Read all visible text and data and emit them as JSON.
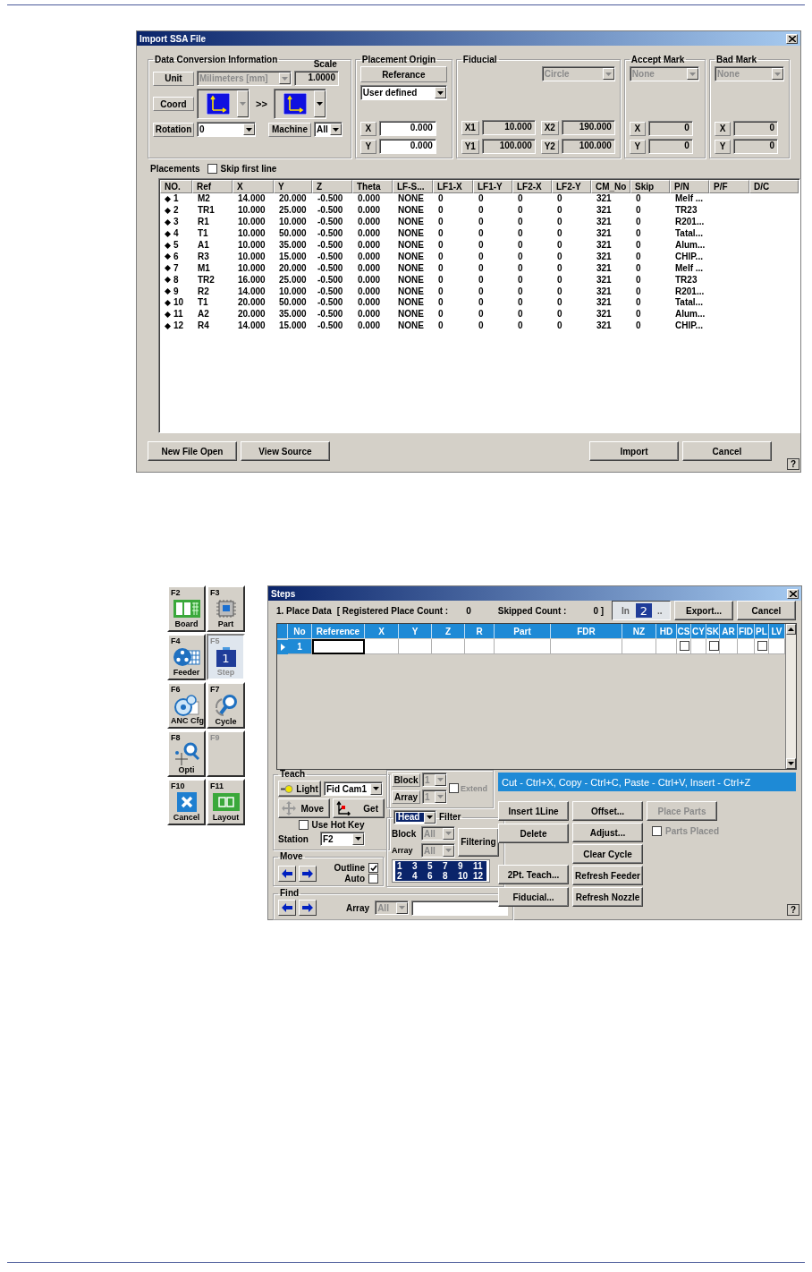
{
  "import_dialog": {
    "title": "Import SSA File",
    "conversion": {
      "title": "Data Conversion Information",
      "scale_label": "Scale",
      "unit_label": "Unit",
      "unit": {
        "value": "Milimeters [mm]",
        "disabled": true
      },
      "scale": {
        "value": "1.0000",
        "disabled": true
      },
      "coord_label": "Coord",
      "from_coord": {
        "disabled": true
      },
      "coord_sep": ">>",
      "to_coord": {
        "disabled": false
      },
      "rotation_label": "Rotation",
      "rotation": {
        "value": "0",
        "disabled": false
      },
      "machine_label": "Machine",
      "machine": {
        "value": "All",
        "disabled": false
      }
    },
    "origin": {
      "title": "Placement Origin",
      "reference_label": "Referance",
      "mode": {
        "value": "User defined",
        "disabled": false
      },
      "x_label": "X",
      "x": {
        "value": "0.000",
        "disabled": false
      },
      "y_label": "Y",
      "y": {
        "value": "0.000",
        "disabled": false
      }
    },
    "fiducial": {
      "title": "Fiducial",
      "shape": {
        "value": "Circle",
        "disabled": true
      },
      "points": [
        {
          "label": "X1",
          "value": "10.000",
          "disabled": true
        },
        {
          "label": "X2",
          "value": "190.000",
          "disabled": true
        },
        {
          "label": "Y1",
          "value": "100.000",
          "disabled": true
        },
        {
          "label": "Y2",
          "value": "100.000",
          "disabled": true
        }
      ]
    },
    "marks": [
      {
        "title": "Accept Mark",
        "type": {
          "value": "None",
          "disabled": true
        },
        "x_label": "X",
        "x": {
          "value": "0",
          "disabled": true
        },
        "y_label": "Y",
        "y": {
          "value": "0",
          "disabled": true
        }
      },
      {
        "title": "Bad Mark",
        "type": {
          "value": "None",
          "disabled": true
        },
        "x_label": "X",
        "x": {
          "value": "0",
          "disabled": true
        },
        "y_label": "Y",
        "y": {
          "value": "0",
          "disabled": true
        }
      }
    ],
    "placements_label": "Placements",
    "skip_first_line": {
      "label": "Skip first line",
      "checked": false
    },
    "table": {
      "columns": [
        "NO.",
        "Ref",
        "X",
        "Y",
        "Z",
        "Theta",
        "LF-S...",
        "LF1-X",
        "LF1-Y",
        "LF2-X",
        "LF2-Y",
        "CM_No",
        "Skip",
        "P/N",
        "P/F",
        "D/C"
      ],
      "rows": [
        {
          "cells": [
            "1",
            "M2",
            "14.000",
            "20.000",
            "-0.500",
            "0.000",
            "NONE",
            "0",
            "0",
            "0",
            "0",
            "321",
            "0",
            "Melf ..."
          ]
        },
        {
          "cells": [
            "2",
            "TR1",
            "10.000",
            "25.000",
            "-0.500",
            "0.000",
            "NONE",
            "0",
            "0",
            "0",
            "0",
            "321",
            "0",
            "TR23"
          ]
        },
        {
          "cells": [
            "3",
            "R1",
            "10.000",
            "10.000",
            "-0.500",
            "0.000",
            "NONE",
            "0",
            "0",
            "0",
            "0",
            "321",
            "0",
            "R201..."
          ]
        },
        {
          "cells": [
            "4",
            "T1",
            "10.000",
            "50.000",
            "-0.500",
            "0.000",
            "NONE",
            "0",
            "0",
            "0",
            "0",
            "321",
            "0",
            "Tatal..."
          ]
        },
        {
          "cells": [
            "5",
            "A1",
            "10.000",
            "35.000",
            "-0.500",
            "0.000",
            "NONE",
            "0",
            "0",
            "0",
            "0",
            "321",
            "0",
            "Alum..."
          ]
        },
        {
          "cells": [
            "6",
            "R3",
            "10.000",
            "15.000",
            "-0.500",
            "0.000",
            "NONE",
            "0",
            "0",
            "0",
            "0",
            "321",
            "0",
            "CHIP..."
          ]
        },
        {
          "cells": [
            "7",
            "M1",
            "10.000",
            "20.000",
            "-0.500",
            "0.000",
            "NONE",
            "0",
            "0",
            "0",
            "0",
            "321",
            "0",
            "Melf ..."
          ]
        },
        {
          "cells": [
            "8",
            "TR2",
            "16.000",
            "25.000",
            "-0.500",
            "0.000",
            "NONE",
            "0",
            "0",
            "0",
            "0",
            "321",
            "0",
            "TR23"
          ]
        },
        {
          "cells": [
            "9",
            "R2",
            "14.000",
            "10.000",
            "-0.500",
            "0.000",
            "NONE",
            "0",
            "0",
            "0",
            "0",
            "321",
            "0",
            "R201..."
          ]
        },
        {
          "cells": [
            "10",
            "T1",
            "20.000",
            "50.000",
            "-0.500",
            "0.000",
            "NONE",
            "0",
            "0",
            "0",
            "0",
            "321",
            "0",
            "Tatal..."
          ]
        },
        {
          "cells": [
            "11",
            "A2",
            "20.000",
            "35.000",
            "-0.500",
            "0.000",
            "NONE",
            "0",
            "0",
            "0",
            "0",
            "321",
            "0",
            "Alum..."
          ]
        },
        {
          "cells": [
            "12",
            "R4",
            "14.000",
            "15.000",
            "-0.500",
            "0.000",
            "NONE",
            "0",
            "0",
            "0",
            "0",
            "321",
            "0",
            "CHIP..."
          ]
        }
      ]
    },
    "left_buttons": [
      "New File Open",
      "View Source"
    ],
    "right_buttons": [
      "Import",
      "Cancel"
    ],
    "help": "?"
  },
  "function_keys": [
    {
      "key": "F2",
      "label": "Board",
      "selected": false,
      "disabled": false
    },
    {
      "key": "F3",
      "label": "Part",
      "selected": false,
      "disabled": false
    },
    {
      "key": "F4",
      "label": "Feeder",
      "selected": false,
      "disabled": false
    },
    {
      "key": "F5",
      "label": "Step",
      "selected": true,
      "disabled": false,
      "callout": "1"
    },
    {
      "key": "F6",
      "label": "ANC Cfg",
      "selected": false,
      "disabled": false
    },
    {
      "key": "F7",
      "label": "Cycle",
      "selected": false,
      "disabled": false
    },
    {
      "key": "F8",
      "label": "Opti",
      "selected": false,
      "disabled": false
    },
    {
      "key": "F9",
      "selected": false,
      "disabled": true
    },
    {
      "key": "F10",
      "label": "Cancel",
      "selected": false,
      "disabled": false
    },
    {
      "key": "F11",
      "label": "Layout",
      "selected": false,
      "disabled": false
    }
  ],
  "steps_dialog": {
    "title": "Steps",
    "place_data": "1. Place Data",
    "registered_label": "[ Registered Place Count :",
    "registered_value": "0",
    "skipped_label": "Skipped Count :",
    "skipped_value": "0 ]",
    "buttons": [
      {
        "label": "In",
        "tail": "..",
        "pressed": true,
        "callout": "2"
      },
      {
        "label": "Export...",
        "pressed": false
      },
      {
        "label": "Cancel",
        "pressed": false
      }
    ],
    "grid": {
      "columns": [
        "No",
        "Reference",
        "X",
        "Y",
        "Z",
        "R",
        "Part",
        "FDR",
        "NZ",
        "HD",
        "CS",
        "CY",
        "SK",
        "AR",
        "FID",
        "PL",
        "LV"
      ],
      "rows": [
        {
          "selected": true,
          "cells": [
            {
              "kind": "text",
              "value": "1"
            },
            {
              "kind": "edit"
            },
            {
              "kind": "empty"
            },
            {
              "kind": "empty"
            },
            {
              "kind": "empty"
            },
            {
              "kind": "empty"
            },
            {
              "kind": "empty"
            },
            {
              "kind": "empty"
            },
            {
              "kind": "empty"
            },
            {
              "kind": "empty"
            },
            {
              "kind": "check",
              "checked": false
            },
            {
              "kind": "empty"
            },
            {
              "kind": "check",
              "checked": false
            },
            {
              "kind": "empty"
            },
            {
              "kind": "empty"
            },
            {
              "kind": "check",
              "checked": false
            },
            {
              "kind": "empty"
            }
          ]
        }
      ]
    },
    "teach": {
      "title": "Teach",
      "light_button": "Light",
      "camera": {
        "value": "Fid Cam1",
        "disabled": false
      },
      "move_button": "Move",
      "get_button": "Get",
      "hot_key": {
        "label": "Use Hot Key",
        "checked": false,
        "disabled": false
      },
      "station_label": "Station",
      "station": {
        "value": "F2",
        "disabled": false
      }
    },
    "move": {
      "title": "Move",
      "outline": {
        "label": "Outline",
        "checked": true,
        "disabled": false
      },
      "auto": {
        "label": "Auto",
        "checked": false,
        "disabled": false
      }
    },
    "find": {
      "title": "Find",
      "array_label": "Array",
      "array": {
        "value": "All",
        "disabled": true
      }
    },
    "block_array": {
      "block_label": "Block",
      "block": {
        "value": "1",
        "disabled": true
      },
      "array_label": "Array",
      "array": {
        "value": "1",
        "disabled": true
      },
      "extend": {
        "label": "Extend",
        "checked": false,
        "disabled": true
      }
    },
    "filter": {
      "mode": {
        "value": "Head",
        "disabled": false
      },
      "title": "Filter",
      "block_label": "Block",
      "block": {
        "value": "All",
        "disabled": true
      },
      "array_label": "Array",
      "array": {
        "value": "All",
        "disabled": true
      },
      "button": "Filtering",
      "heads": [
        {
          "label": "1",
          "selected": true
        },
        {
          "label": "2",
          "selected": true
        },
        {
          "label": "3",
          "selected": true
        },
        {
          "label": "4",
          "selected": true
        },
        {
          "label": "5",
          "selected": true
        },
        {
          "label": "6",
          "selected": true
        },
        {
          "label": "7",
          "selected": true
        },
        {
          "label": "8",
          "selected": true
        },
        {
          "label": "9",
          "selected": true
        },
        {
          "label": "10",
          "selected": true
        },
        {
          "label": "11",
          "selected": true
        },
        {
          "label": "12",
          "selected": true
        }
      ]
    },
    "hint": "Cut - Ctrl+X, Copy - Ctrl+C, Paste - Ctrl+V, Insert - Ctrl+Z",
    "edit_buttons": [
      "Insert 1Line",
      "Delete"
    ],
    "teach_buttons": [
      "2Pt. Teach...",
      "Fiducial..."
    ],
    "adjust_buttons": [
      "Offset...",
      "Adjust...",
      "Clear Cycle",
      "Refresh Feeder",
      "Refresh Nozzle"
    ],
    "place_parts": {
      "label": "Place Parts",
      "disabled": true
    },
    "parts_placed": {
      "label": "Parts Placed",
      "checked": false,
      "disabled": true
    },
    "help": "?"
  }
}
